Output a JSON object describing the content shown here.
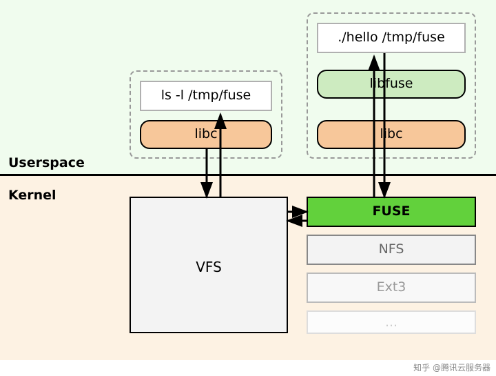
{
  "sections": {
    "userspace_label": "Userspace",
    "kernel_label": "Kernel"
  },
  "userspace": {
    "left_proc": {
      "command": "ls -l /tmp/fuse",
      "libc": "libc"
    },
    "right_proc": {
      "command": "./hello /tmp/fuse",
      "libfuse": "libfuse",
      "libc": "libc"
    }
  },
  "kernel": {
    "vfs": "VFS",
    "filesystems": {
      "fuse": "FUSE",
      "nfs": "NFS",
      "ext3": "Ext3",
      "more": "..."
    }
  },
  "footer": "知乎 @腾讯云服务器"
}
